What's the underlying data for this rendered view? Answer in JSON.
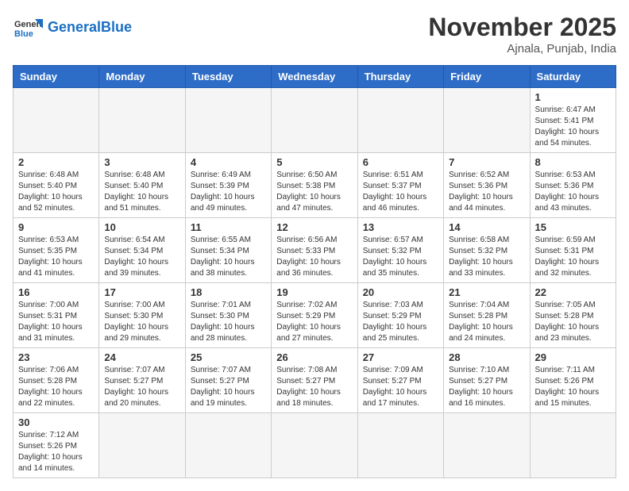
{
  "header": {
    "logo_general": "General",
    "logo_blue": "Blue",
    "month": "November 2025",
    "location": "Ajnala, Punjab, India"
  },
  "days_of_week": [
    "Sunday",
    "Monday",
    "Tuesday",
    "Wednesday",
    "Thursday",
    "Friday",
    "Saturday"
  ],
  "weeks": [
    [
      {
        "day": "",
        "sunrise": "",
        "sunset": "",
        "daylight": ""
      },
      {
        "day": "",
        "sunrise": "",
        "sunset": "",
        "daylight": ""
      },
      {
        "day": "",
        "sunrise": "",
        "sunset": "",
        "daylight": ""
      },
      {
        "day": "",
        "sunrise": "",
        "sunset": "",
        "daylight": ""
      },
      {
        "day": "",
        "sunrise": "",
        "sunset": "",
        "daylight": ""
      },
      {
        "day": "",
        "sunrise": "",
        "sunset": "",
        "daylight": ""
      },
      {
        "day": "1",
        "sunrise": "Sunrise: 6:47 AM",
        "sunset": "Sunset: 5:41 PM",
        "daylight": "Daylight: 10 hours and 54 minutes."
      }
    ],
    [
      {
        "day": "2",
        "sunrise": "Sunrise: 6:48 AM",
        "sunset": "Sunset: 5:40 PM",
        "daylight": "Daylight: 10 hours and 52 minutes."
      },
      {
        "day": "3",
        "sunrise": "Sunrise: 6:48 AM",
        "sunset": "Sunset: 5:40 PM",
        "daylight": "Daylight: 10 hours and 51 minutes."
      },
      {
        "day": "4",
        "sunrise": "Sunrise: 6:49 AM",
        "sunset": "Sunset: 5:39 PM",
        "daylight": "Daylight: 10 hours and 49 minutes."
      },
      {
        "day": "5",
        "sunrise": "Sunrise: 6:50 AM",
        "sunset": "Sunset: 5:38 PM",
        "daylight": "Daylight: 10 hours and 47 minutes."
      },
      {
        "day": "6",
        "sunrise": "Sunrise: 6:51 AM",
        "sunset": "Sunset: 5:37 PM",
        "daylight": "Daylight: 10 hours and 46 minutes."
      },
      {
        "day": "7",
        "sunrise": "Sunrise: 6:52 AM",
        "sunset": "Sunset: 5:36 PM",
        "daylight": "Daylight: 10 hours and 44 minutes."
      },
      {
        "day": "8",
        "sunrise": "Sunrise: 6:53 AM",
        "sunset": "Sunset: 5:36 PM",
        "daylight": "Daylight: 10 hours and 43 minutes."
      }
    ],
    [
      {
        "day": "9",
        "sunrise": "Sunrise: 6:53 AM",
        "sunset": "Sunset: 5:35 PM",
        "daylight": "Daylight: 10 hours and 41 minutes."
      },
      {
        "day": "10",
        "sunrise": "Sunrise: 6:54 AM",
        "sunset": "Sunset: 5:34 PM",
        "daylight": "Daylight: 10 hours and 39 minutes."
      },
      {
        "day": "11",
        "sunrise": "Sunrise: 6:55 AM",
        "sunset": "Sunset: 5:34 PM",
        "daylight": "Daylight: 10 hours and 38 minutes."
      },
      {
        "day": "12",
        "sunrise": "Sunrise: 6:56 AM",
        "sunset": "Sunset: 5:33 PM",
        "daylight": "Daylight: 10 hours and 36 minutes."
      },
      {
        "day": "13",
        "sunrise": "Sunrise: 6:57 AM",
        "sunset": "Sunset: 5:32 PM",
        "daylight": "Daylight: 10 hours and 35 minutes."
      },
      {
        "day": "14",
        "sunrise": "Sunrise: 6:58 AM",
        "sunset": "Sunset: 5:32 PM",
        "daylight": "Daylight: 10 hours and 33 minutes."
      },
      {
        "day": "15",
        "sunrise": "Sunrise: 6:59 AM",
        "sunset": "Sunset: 5:31 PM",
        "daylight": "Daylight: 10 hours and 32 minutes."
      }
    ],
    [
      {
        "day": "16",
        "sunrise": "Sunrise: 7:00 AM",
        "sunset": "Sunset: 5:31 PM",
        "daylight": "Daylight: 10 hours and 31 minutes."
      },
      {
        "day": "17",
        "sunrise": "Sunrise: 7:00 AM",
        "sunset": "Sunset: 5:30 PM",
        "daylight": "Daylight: 10 hours and 29 minutes."
      },
      {
        "day": "18",
        "sunrise": "Sunrise: 7:01 AM",
        "sunset": "Sunset: 5:30 PM",
        "daylight": "Daylight: 10 hours and 28 minutes."
      },
      {
        "day": "19",
        "sunrise": "Sunrise: 7:02 AM",
        "sunset": "Sunset: 5:29 PM",
        "daylight": "Daylight: 10 hours and 27 minutes."
      },
      {
        "day": "20",
        "sunrise": "Sunrise: 7:03 AM",
        "sunset": "Sunset: 5:29 PM",
        "daylight": "Daylight: 10 hours and 25 minutes."
      },
      {
        "day": "21",
        "sunrise": "Sunrise: 7:04 AM",
        "sunset": "Sunset: 5:28 PM",
        "daylight": "Daylight: 10 hours and 24 minutes."
      },
      {
        "day": "22",
        "sunrise": "Sunrise: 7:05 AM",
        "sunset": "Sunset: 5:28 PM",
        "daylight": "Daylight: 10 hours and 23 minutes."
      }
    ],
    [
      {
        "day": "23",
        "sunrise": "Sunrise: 7:06 AM",
        "sunset": "Sunset: 5:28 PM",
        "daylight": "Daylight: 10 hours and 22 minutes."
      },
      {
        "day": "24",
        "sunrise": "Sunrise: 7:07 AM",
        "sunset": "Sunset: 5:27 PM",
        "daylight": "Daylight: 10 hours and 20 minutes."
      },
      {
        "day": "25",
        "sunrise": "Sunrise: 7:07 AM",
        "sunset": "Sunset: 5:27 PM",
        "daylight": "Daylight: 10 hours and 19 minutes."
      },
      {
        "day": "26",
        "sunrise": "Sunrise: 7:08 AM",
        "sunset": "Sunset: 5:27 PM",
        "daylight": "Daylight: 10 hours and 18 minutes."
      },
      {
        "day": "27",
        "sunrise": "Sunrise: 7:09 AM",
        "sunset": "Sunset: 5:27 PM",
        "daylight": "Daylight: 10 hours and 17 minutes."
      },
      {
        "day": "28",
        "sunrise": "Sunrise: 7:10 AM",
        "sunset": "Sunset: 5:27 PM",
        "daylight": "Daylight: 10 hours and 16 minutes."
      },
      {
        "day": "29",
        "sunrise": "Sunrise: 7:11 AM",
        "sunset": "Sunset: 5:26 PM",
        "daylight": "Daylight: 10 hours and 15 minutes."
      }
    ],
    [
      {
        "day": "30",
        "sunrise": "Sunrise: 7:12 AM",
        "sunset": "Sunset: 5:26 PM",
        "daylight": "Daylight: 10 hours and 14 minutes."
      },
      {
        "day": "",
        "sunrise": "",
        "sunset": "",
        "daylight": ""
      },
      {
        "day": "",
        "sunrise": "",
        "sunset": "",
        "daylight": ""
      },
      {
        "day": "",
        "sunrise": "",
        "sunset": "",
        "daylight": ""
      },
      {
        "day": "",
        "sunrise": "",
        "sunset": "",
        "daylight": ""
      },
      {
        "day": "",
        "sunrise": "",
        "sunset": "",
        "daylight": ""
      },
      {
        "day": "",
        "sunrise": "",
        "sunset": "",
        "daylight": ""
      }
    ]
  ]
}
